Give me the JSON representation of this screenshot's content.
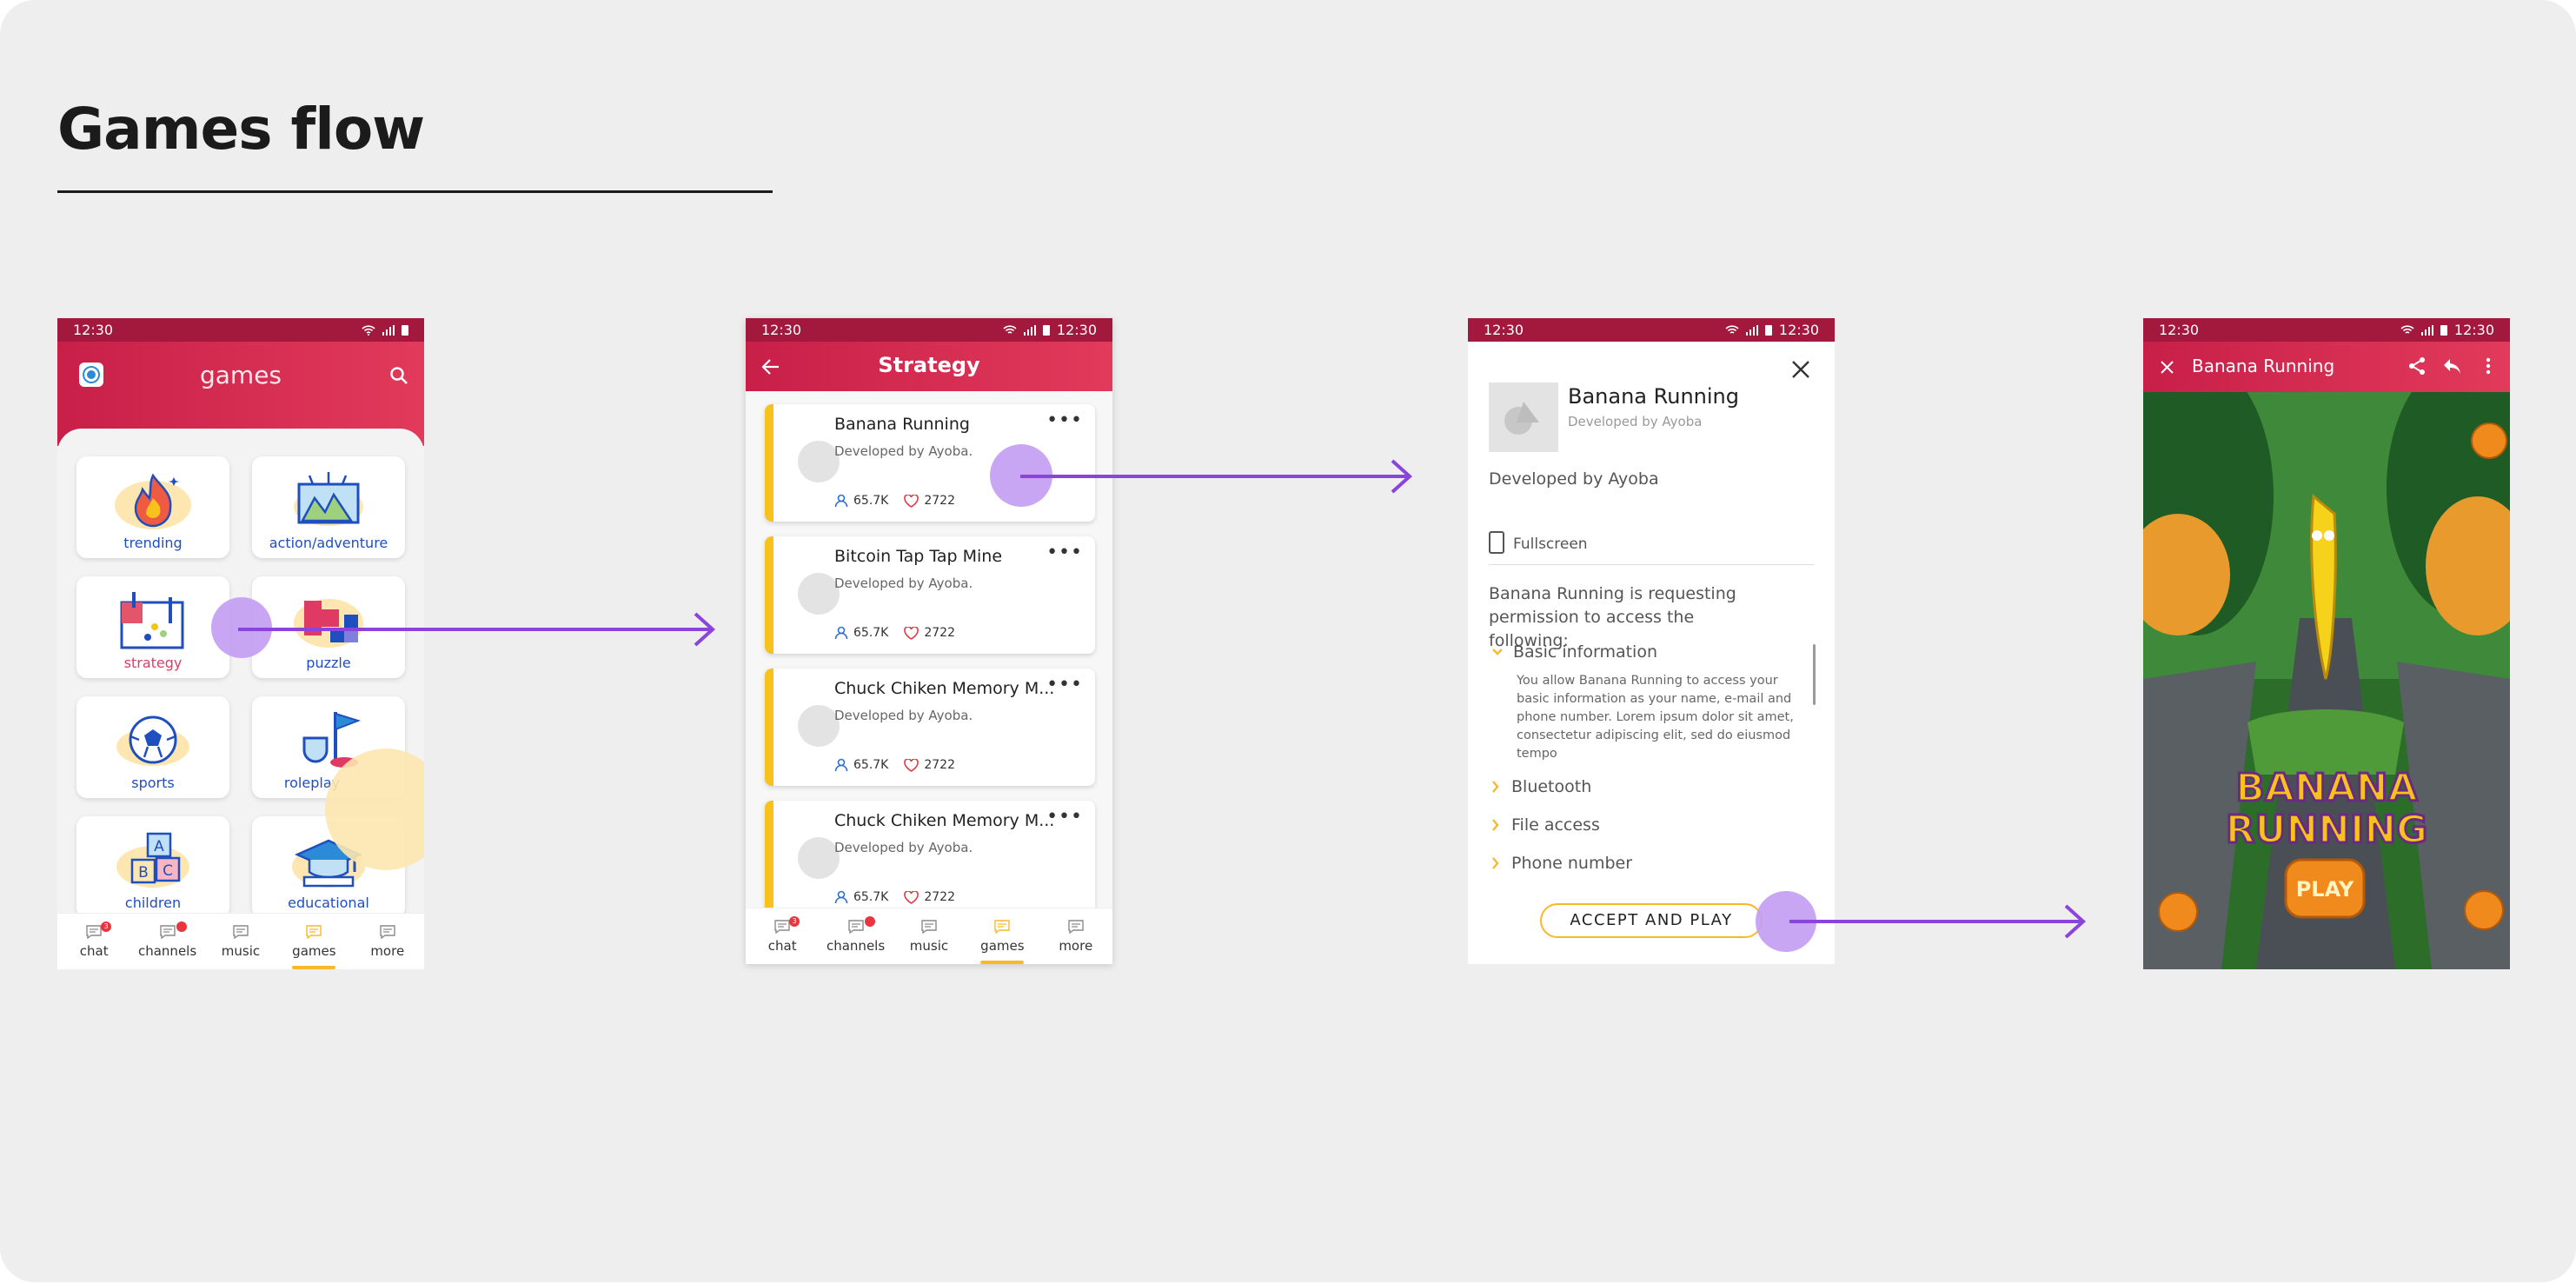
{
  "page_title": "Games flow",
  "colors": {
    "accent_dark": "#a3183d",
    "accent": "#d7294f",
    "flow_arrow": "#8a44dc",
    "touch": "#c39cf2",
    "highlight": "#f7c21b"
  },
  "status_time": "12:30",
  "screen1": {
    "title": "games",
    "categories": [
      "trending",
      "action/adventure",
      "strategy",
      "puzzle",
      "sports",
      "roleplay",
      "children",
      "educational"
    ],
    "nav": [
      {
        "label": "chat",
        "badge": "3"
      },
      {
        "label": "channels",
        "badge": ""
      },
      {
        "label": "music",
        "badge": ""
      },
      {
        "label": "games",
        "badge": ""
      },
      {
        "label": "more",
        "badge": ""
      }
    ],
    "active_nav": "games"
  },
  "screen2": {
    "title": "Strategy",
    "games": [
      {
        "name": "Banana Running",
        "dev": "Developed by Ayoba.",
        "players": "65.7K",
        "likes": "2722"
      },
      {
        "name": "Bitcoin Tap Tap Mine",
        "dev": "Developed by Ayoba.",
        "players": "65.7K",
        "likes": "2722"
      },
      {
        "name": "Chuck Chiken Memory M...",
        "dev": "Developed by Ayoba.",
        "players": "65.7K",
        "likes": "2722"
      },
      {
        "name": "Chuck Chiken Memory M...",
        "dev": "Developed by Ayoba.",
        "players": "65.7K",
        "likes": "2722"
      }
    ]
  },
  "screen3": {
    "game_name": "Banana Running",
    "dev_small": "Developed by Ayoba",
    "dev_line": "Developed by Ayoba",
    "fullscreen_label": "Fullscreen",
    "request_text": "Banana Running is requesting permission to access the following:",
    "basic_info_title": "Basic information",
    "basic_info_text": "You allow Banana Running to access your basic information as your name, e-mail and phone number. Lorem ipsum dolor sit amet, consectetur adipiscing elit, sed do eiusmod tempo",
    "permissions": [
      "Bluetooth",
      "File access",
      "Phone number"
    ],
    "accept_button": "ACCEPT AND PLAY"
  },
  "screen4": {
    "title": "Banana Running",
    "logo_line1": "BANANA",
    "logo_line2": "RUNNING",
    "play_button": "PLAY"
  }
}
